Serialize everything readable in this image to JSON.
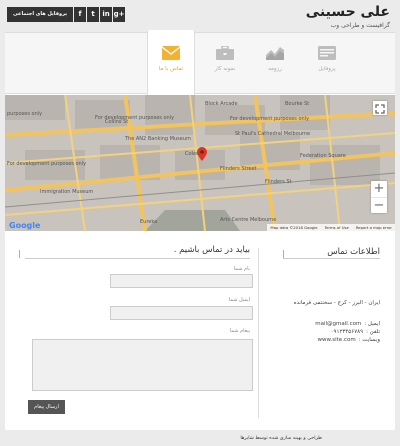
{
  "header": {
    "name": "علی حسینی",
    "tagline": "گرافیست و طراحی وب",
    "social_label": "پروفایل های اجتماعی",
    "social_icons": [
      "f",
      "t",
      "in",
      "g+"
    ]
  },
  "tabs": [
    {
      "label": "پروفایل",
      "icon": "profile-card-icon"
    },
    {
      "label": "رزومه",
      "icon": "chart-icon"
    },
    {
      "label": "نمونه کار",
      "icon": "briefcase-icon"
    },
    {
      "label": "تماس با ما",
      "icon": "envelope-icon",
      "active": true
    }
  ],
  "map": {
    "labels": [
      "purposes only",
      "For development purposes only",
      "For development purposes only",
      "For development purposes only",
      "The AN2 Banking Museum",
      "Coles",
      "Block Arcade",
      "St Paul's Cathedral Melbourne",
      "Federation Square",
      "Flinders Street",
      "Immigration Museum",
      "Arts Centre Melbourne",
      "Google",
      "Eureka",
      "Collins St",
      "Flinders St",
      "Bourke St"
    ],
    "attribution": [
      "Map data ©2018 Google",
      "Terms of Use",
      "Report a map error"
    ],
    "zoom_in": "+",
    "zoom_out": "−"
  },
  "contact_info": {
    "title": "اطلاعات تماس",
    "address": "ایران - البرز - کرج - سخنتمی فرمانده",
    "email_label": "ایمیل :",
    "email": "mail@gmail.com",
    "phone_label": "تلفن :",
    "phone": "۰۹۱۲۳۴۵۶۷۸۹",
    "website_label": "وبسایت :",
    "website": "www.site.com"
  },
  "form": {
    "title": "بیاید در تماس باشیم .",
    "name_label": "نام شما",
    "email_label": "ایمیل شما",
    "message_label": "پیغام شما",
    "send_label": "ارسال پیغام"
  },
  "footer": {
    "text": "طراحی و بهینه سازی شده توسط شایرها"
  },
  "colors": {
    "accent": "#e9a825",
    "dark": "#333333"
  }
}
